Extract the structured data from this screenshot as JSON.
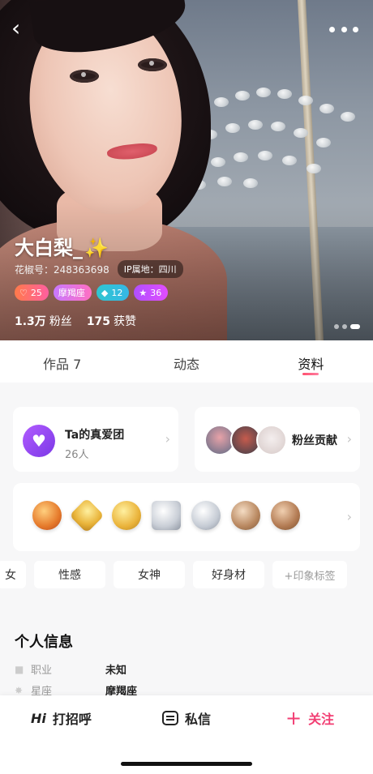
{
  "nav": {
    "back_icon": "back-arrow-icon",
    "more_icon": "more-dots-icon"
  },
  "profile": {
    "nickname": "大白梨_",
    "nickname_emoji": "✨",
    "uid": "花椒号：248363698",
    "ip_location": "IP属地：四川",
    "badges": [
      {
        "icon": "heart-level-icon",
        "value": "25"
      },
      {
        "icon": "",
        "value": "摩羯座"
      },
      {
        "icon": "diamond-icon",
        "value": "12"
      },
      {
        "icon": "star-icon",
        "value": "36"
      }
    ],
    "fans_count": "1.3万",
    "fans_label": "粉丝",
    "likes_count": "175",
    "likes_label": "获赞"
  },
  "tabs": [
    "作品 7",
    "动态",
    "资料"
  ],
  "active_tab": "资料",
  "fan_group": {
    "title": "Ta的真爱团",
    "subtitle": "26人"
  },
  "contribution": {
    "title": "粉丝贡献"
  },
  "medals": [
    "medal-1",
    "medal-2",
    "medal-3",
    "medal-4",
    "medal-5",
    "medal-6",
    "medal-7"
  ],
  "tags": {
    "partial": "女",
    "items": [
      "性感",
      "女神",
      "好身材"
    ],
    "add_label": "+印象标签"
  },
  "info": {
    "title": "个人信息",
    "rows": [
      {
        "icon": "briefcase-icon",
        "key": "职业",
        "value": "未知"
      },
      {
        "icon": "constellation-icon",
        "key": "星座",
        "value": "摩羯座"
      }
    ]
  },
  "bottom_bar": {
    "greet_icon": "Hi",
    "greet_label": "打招呼",
    "message_label": "私信",
    "follow_label": "关注"
  },
  "colors": {
    "accent": "#f23e73",
    "fan_group": "#9b4cf2",
    "tab_indicator": "#ff4f6e"
  }
}
